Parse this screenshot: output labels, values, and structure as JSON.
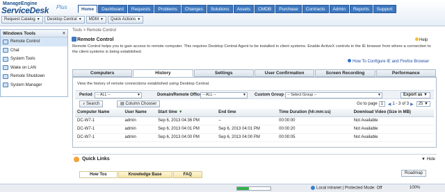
{
  "app": {
    "brand_top": "ManageEngine",
    "brand_name": "ServiceDesk",
    "brand_plus": "Plus"
  },
  "modules": [
    "Home",
    "Dashboard",
    "Requests",
    "Problems",
    "Changes",
    "Solutions",
    "Assets",
    "CMDB",
    "Purchase",
    "Contracts",
    "Admin",
    "Reports",
    "Support"
  ],
  "active_module": "Home",
  "toolbar": {
    "request_catalog": "Request Catalog",
    "desktop_central": "Desktop Central",
    "mdm": "MDM",
    "quick_actions": "Quick Actions"
  },
  "sidebar": {
    "title": "Windows Tools",
    "close": "×",
    "items": [
      {
        "label": "Remote Control",
        "icon": "monitor-icon"
      },
      {
        "label": "Chat",
        "icon": "chat-icon"
      },
      {
        "label": "System Tools",
        "icon": "tools-icon"
      },
      {
        "label": "Wake on LAN",
        "icon": "power-icon"
      },
      {
        "label": "Remote Shutdown",
        "icon": "shutdown-icon"
      },
      {
        "label": "System Manager",
        "icon": "manager-icon"
      }
    ]
  },
  "breadcrumb": "Tools > Remote Control",
  "page_title": "Remote Control",
  "help": "Help",
  "description": "Remote Control helps you to gain access to remote computer. This requires Desktop Central Agent to be installed in client systems. Enable ActiveX controls in the IE browser from where a connection to the client systems is being established.",
  "howto_link": "How To Configure IE and Firefox Browser",
  "tabs": [
    "Computers",
    "History",
    "Settings",
    "User Confirmation",
    "Screen Recording",
    "Performance"
  ],
  "active_tab": "History",
  "history": {
    "desc": "View the history of remote connections established using Desktop Central.",
    "filters": {
      "period_label": "Period",
      "period_value": "-- ALL --",
      "domain_label": "Domain/Remote Office",
      "domain_value": "-- ALL --",
      "group_label": "Custom Group",
      "group_value": "-- Select Group --",
      "export": "Export as"
    },
    "search_btn": "Search",
    "column_chooser": "Column Chooser",
    "pager": {
      "go_to": "Go to page",
      "page": "1",
      "range": "1 - 3 of 3",
      "per_page": "25"
    },
    "columns": [
      "Computer Name",
      "User Name",
      "Start time",
      "End time",
      "Time Duration (hh:mm:ss)",
      "Download Video (Size in MB)"
    ],
    "rows": [
      [
        "DC-W7-1",
        "admin",
        "Sep 6, 2013 04:36 PM",
        "--",
        "00:00:00",
        "Not Available"
      ],
      [
        "DC-W7-1",
        "admin",
        "Sep 6, 2013 04:01 PM",
        "Sep 6, 2013 04:01 PM",
        "00:00:20",
        "Not Available"
      ],
      [
        "DC-W7-1",
        "admin",
        "Sep 6, 2013 04:00 PM",
        "Sep 6, 2013 04:00 PM",
        "00:00:05",
        "Not Available"
      ]
    ]
  },
  "quick_links": {
    "title": "Quick Links",
    "hide": "Hide",
    "tabs": [
      "How Tos",
      "Knowledge Base",
      "FAQ"
    ],
    "roadmap": "Roadmap"
  },
  "statusbar": {
    "zone": "Local intranet | Protected Mode: Off",
    "zoom": "100%",
    "progress": 0.35
  }
}
